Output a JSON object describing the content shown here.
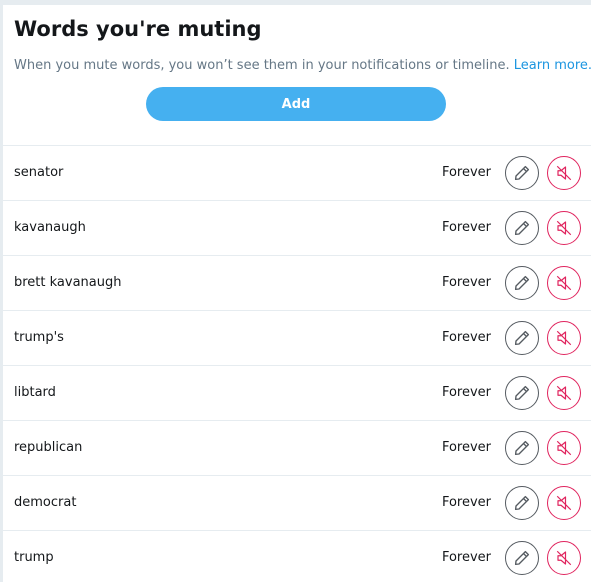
{
  "header": {
    "title": "Words you're muting",
    "subtitle": "When you mute words, you won’t see them in your notifications or timeline.",
    "learn_more": "Learn more.",
    "add_label": "Add"
  },
  "colors": {
    "accent": "#45b0f0",
    "link": "#1b95e0",
    "unmute": "#e0245e",
    "edit": "#555b61"
  },
  "icons": {
    "edit": "pencil-icon",
    "unmute": "speaker-muted-icon"
  },
  "muted_words": [
    {
      "word": "senator",
      "duration": "Forever"
    },
    {
      "word": "kavanaugh",
      "duration": "Forever"
    },
    {
      "word": "brett kavanaugh",
      "duration": "Forever"
    },
    {
      "word": "trump's",
      "duration": "Forever"
    },
    {
      "word": "libtard",
      "duration": "Forever"
    },
    {
      "word": "republican",
      "duration": "Forever"
    },
    {
      "word": "democrat",
      "duration": "Forever"
    },
    {
      "word": "trump",
      "duration": "Forever"
    }
  ]
}
